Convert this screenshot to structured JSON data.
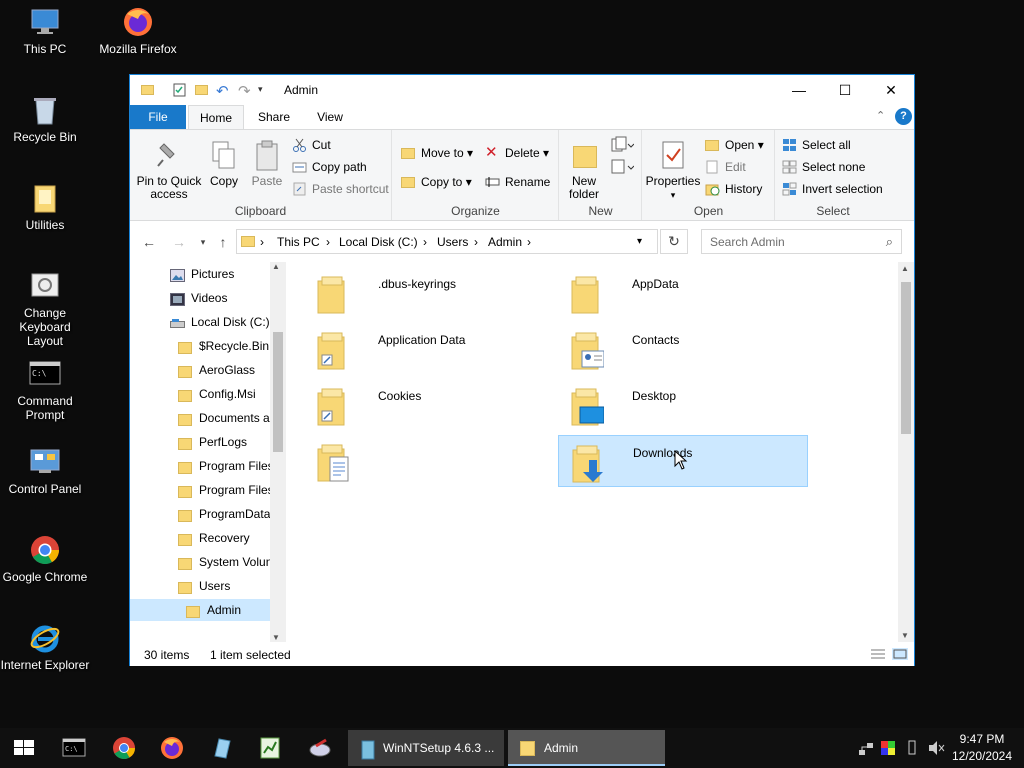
{
  "desktop": {
    "icons": [
      {
        "label": "This PC",
        "icon": "this-pc-icon"
      },
      {
        "label": "Mozilla Firefox",
        "icon": "firefox-icon"
      },
      {
        "label": "Recycle Bin",
        "icon": "recycle-bin-icon"
      },
      {
        "label": "Utilities",
        "icon": "folder-icon"
      },
      {
        "label": "Change Keyboard Layout",
        "icon": "keyboard-layout-icon"
      },
      {
        "label": "Command Prompt",
        "icon": "command-prompt-icon"
      },
      {
        "label": "Control Panel",
        "icon": "control-panel-icon"
      },
      {
        "label": "Google Chrome",
        "icon": "chrome-icon"
      },
      {
        "label": "Internet Explorer",
        "icon": "ie-icon"
      }
    ]
  },
  "window": {
    "title": "Admin",
    "tabs": {
      "file": "File",
      "home": "Home",
      "share": "Share",
      "view": "View"
    },
    "ribbon": {
      "clipboard": {
        "name": "Clipboard",
        "pin_line1": "Pin to Quick",
        "pin_line2": "access",
        "copy": "Copy",
        "paste": "Paste",
        "cut": "Cut",
        "copy_path": "Copy path",
        "paste_shortcut": "Paste shortcut"
      },
      "organize": {
        "name": "Organize",
        "move_to": "Move to",
        "copy_to": "Copy to",
        "delete": "Delete",
        "rename": "Rename"
      },
      "new": {
        "name": "New",
        "new_folder_line1": "New",
        "new_folder_line2": "folder"
      },
      "open": {
        "name": "Open",
        "properties": "Properties",
        "open": "Open",
        "edit": "Edit",
        "history": "History"
      },
      "select": {
        "name": "Select",
        "select_all": "Select all",
        "select_none": "Select none",
        "invert": "Invert selection"
      }
    },
    "address": {
      "crumbs": [
        "This PC",
        "Local Disk (C:)",
        "Users",
        "Admin"
      ],
      "search_placeholder": "Search Admin"
    },
    "nav": [
      {
        "label": "Pictures",
        "indent": 1,
        "icon": "pictures-icon"
      },
      {
        "label": "Videos",
        "indent": 1,
        "icon": "videos-icon"
      },
      {
        "label": "Local Disk (C:)",
        "indent": 1,
        "icon": "drive-icon"
      },
      {
        "label": "$Recycle.Bin",
        "indent": 2,
        "icon": "folder-icon"
      },
      {
        "label": "AeroGlass",
        "indent": 2,
        "icon": "folder-icon"
      },
      {
        "label": "Config.Msi",
        "indent": 2,
        "icon": "folder-icon"
      },
      {
        "label": "Documents a",
        "indent": 2,
        "icon": "folder-icon"
      },
      {
        "label": "PerfLogs",
        "indent": 2,
        "icon": "folder-icon"
      },
      {
        "label": "Program Files",
        "indent": 2,
        "icon": "folder-icon"
      },
      {
        "label": "Program Files",
        "indent": 2,
        "icon": "folder-icon"
      },
      {
        "label": "ProgramData",
        "indent": 2,
        "icon": "folder-icon"
      },
      {
        "label": "Recovery",
        "indent": 2,
        "icon": "folder-icon"
      },
      {
        "label": "System Volun",
        "indent": 2,
        "icon": "folder-icon"
      },
      {
        "label": "Users",
        "indent": 2,
        "icon": "folder-icon"
      },
      {
        "label": "Admin",
        "indent": 3,
        "icon": "folder-icon",
        "selected": true
      }
    ],
    "files": [
      {
        "label": ".dbus-keyrings",
        "icon": "folder-icon",
        "col": 0,
        "row": 0
      },
      {
        "label": "AppData",
        "icon": "folder-icon",
        "col": 1,
        "row": 0
      },
      {
        "label": "Application Data",
        "icon": "folder-shortcut-icon",
        "col": 0,
        "row": 1
      },
      {
        "label": "Contacts",
        "icon": "contacts-folder-icon",
        "col": 1,
        "row": 1
      },
      {
        "label": "Cookies",
        "icon": "folder-shortcut-icon",
        "col": 0,
        "row": 2
      },
      {
        "label": "Desktop",
        "icon": "desktop-folder-icon",
        "col": 1,
        "row": 2
      },
      {
        "label": "",
        "icon": "documents-folder-icon",
        "col": 0,
        "row": 3
      },
      {
        "label": "Downloads",
        "icon": "downloads-folder-icon",
        "col": 1,
        "row": 3,
        "selected": true
      }
    ],
    "status": {
      "count": "30 items",
      "selected": "1 item selected"
    }
  },
  "taskbar": {
    "apps": [
      {
        "label": "WinNTSetup 4.6.3 ...",
        "icon": "winntsetup-icon"
      },
      {
        "label": "Admin",
        "icon": "folder-icon",
        "active": true
      }
    ],
    "time": "9:47 PM",
    "date": "12/20/2024"
  },
  "colors": {
    "accent": "#1979ca",
    "selection": "#cce8ff",
    "folder": "#f8d775"
  }
}
